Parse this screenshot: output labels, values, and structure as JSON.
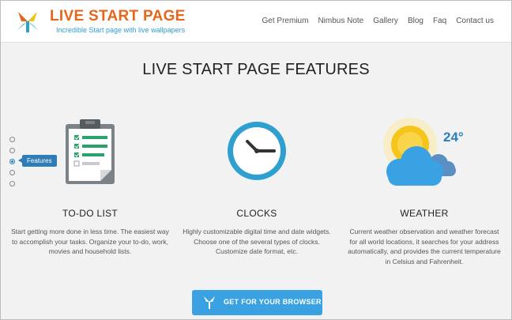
{
  "header": {
    "brand_title": "LIVE START PAGE",
    "brand_tagline": "Incredible Start page with live wallpapers",
    "nav": [
      {
        "label": "Get Premium"
      },
      {
        "label": "Nimbus Note"
      },
      {
        "label": "Gallery"
      },
      {
        "label": "Blog"
      },
      {
        "label": "Faq"
      },
      {
        "label": "Contact us"
      }
    ]
  },
  "main": {
    "title": "LIVE START PAGE FEATURES",
    "pager": {
      "count": 5,
      "active_index": 2,
      "tooltip": "Features"
    },
    "features": [
      {
        "title": "TO-DO LIST",
        "icon": "clipboard-checklist-icon",
        "description": "Start getting more done in less time. The easiest way to accomplish your tasks. Organize your to-do, work, movies and household lists."
      },
      {
        "title": "CLOCKS",
        "icon": "clock-icon",
        "description": "Highly customizable digital time and date widgets. Choose one of the several types of clocks. Customize date format, etc."
      },
      {
        "title": "WEATHER",
        "icon": "weather-sun-cloud-icon",
        "temperature": "24°",
        "description": "Current weather observation and weather forecast for all world locations, it searches for your address automatically, and provides the current temperature in Celsius and Fahrenheit."
      }
    ],
    "cta": {
      "label": "GET FOR YOUR BROWSER",
      "icon": "app-logo-icon"
    }
  },
  "colors": {
    "brand_orange": "#e8651a",
    "tagline_blue": "#2f9fd0",
    "cta_blue": "#3aa2e3",
    "background": "#f2f2f2"
  }
}
